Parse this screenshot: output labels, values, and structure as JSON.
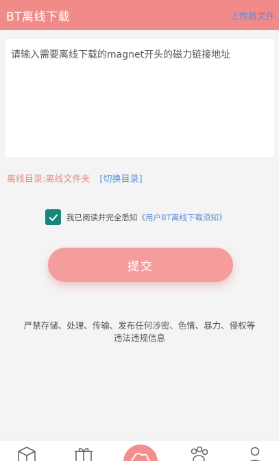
{
  "header": {
    "title": "BT离线下载",
    "upload_link": "上传新文件"
  },
  "input": {
    "placeholder": "请输入需要离线下载的magnet开头的磁力链接地址",
    "value": ""
  },
  "directory": {
    "label": "离线目录:离线文件夹",
    "switch_label": "[切换目录]"
  },
  "agreement": {
    "checked": true,
    "text": "我已阅读并完全悉知",
    "link": "《用户BT离线下载须知》"
  },
  "submit": {
    "label": "提交"
  },
  "notice": {
    "line1": "严禁存储、处理、传输、发布任何涉密、色情、暴力、侵权等",
    "line2": "违法违规信息"
  },
  "tabbar": {
    "icons": [
      "box-icon",
      "gift-icon",
      "cloud-icon",
      "paw-icon",
      "user-icon"
    ]
  },
  "colors": {
    "accent": "#f08b8a",
    "button": "#f59d9c",
    "checkbox": "#16887a",
    "link": "#5b8fd6"
  }
}
